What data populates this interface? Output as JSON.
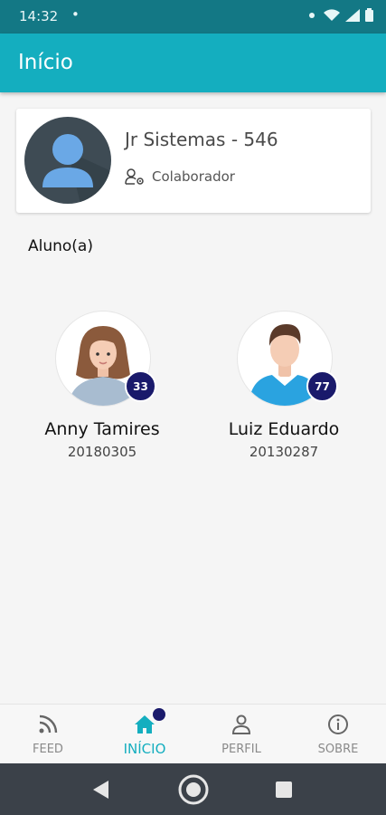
{
  "status_bar": {
    "time": "14:32",
    "dot": "•"
  },
  "app_bar": {
    "title": "Início"
  },
  "profile": {
    "name": "Jr Sistemas - 546",
    "role": "Colaborador"
  },
  "section": {
    "label": "Aluno(a)"
  },
  "students": [
    {
      "name": "Anny Tamires",
      "id": "20180305",
      "badge": "33"
    },
    {
      "name": "Luiz Eduardo",
      "id": "20130287",
      "badge": "77"
    }
  ],
  "bottom_nav": {
    "items": [
      {
        "label": "FEED",
        "icon": "rss-icon"
      },
      {
        "label": "INÍCIO",
        "icon": "home-icon"
      },
      {
        "label": "PERFIL",
        "icon": "person-icon"
      },
      {
        "label": "SOBRE",
        "icon": "info-icon"
      }
    ]
  },
  "colors": {
    "primary": "#14aebf",
    "status_bar": "#137885",
    "badge": "#1a1a6b",
    "system_nav": "#3b4149"
  }
}
